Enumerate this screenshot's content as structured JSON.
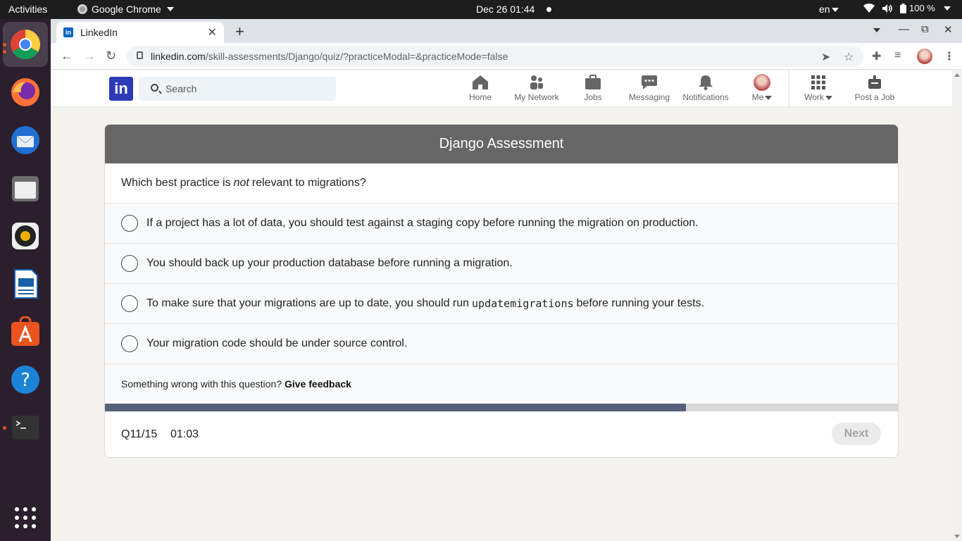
{
  "system_bar": {
    "activities": "Activities",
    "app_name": "Google Chrome",
    "clock": "Dec 26  01:44",
    "language": "en",
    "battery": "100 %"
  },
  "browser": {
    "tab_title": "LinkedIn",
    "url_host": "linkedin.com",
    "url_path": "/skill-assessments/Django/quiz/?practiceModal=&practiceMode=false"
  },
  "linkedin_nav": {
    "logo": "in",
    "search_placeholder": "Search",
    "items": [
      {
        "label": "Home",
        "icon": "home-icon"
      },
      {
        "label": "My Network",
        "icon": "network-icon"
      },
      {
        "label": "Jobs",
        "icon": "briefcase-icon"
      },
      {
        "label": "Messaging",
        "icon": "chat-icon"
      },
      {
        "label": "Notifications",
        "icon": "bell-icon"
      },
      {
        "label": "Me",
        "icon": "avatar"
      },
      {
        "label": "Work",
        "icon": "grid-icon"
      },
      {
        "label": "Post a Job",
        "icon": "post-job-icon"
      }
    ]
  },
  "assessment": {
    "title": "Django Assessment",
    "question_prefix": "Which best practice is",
    "question_emphasis": "not",
    "question_suffix": "relevant to migrations?",
    "options": [
      {
        "text": "If a project has a lot of data, you should test against a staging copy before running the migration on production."
      },
      {
        "text": "You should back up your production database before running a migration."
      },
      {
        "pre": "To make sure that your migrations are up to date, you should run",
        "code": "updatemigrations",
        "post": "before running your tests."
      },
      {
        "text": "Your migration code should be under source control."
      }
    ],
    "feedback_prompt": "Something wrong with this question?",
    "feedback_link": "Give feedback",
    "progress_fraction": 0.733,
    "question_counter": "Q11/15",
    "timer": "01:03",
    "next_label": "Next"
  },
  "colors": {
    "header_bg": "#666666",
    "progress_fill": "#566179",
    "linkedin_logo": "#2c3ab8"
  }
}
